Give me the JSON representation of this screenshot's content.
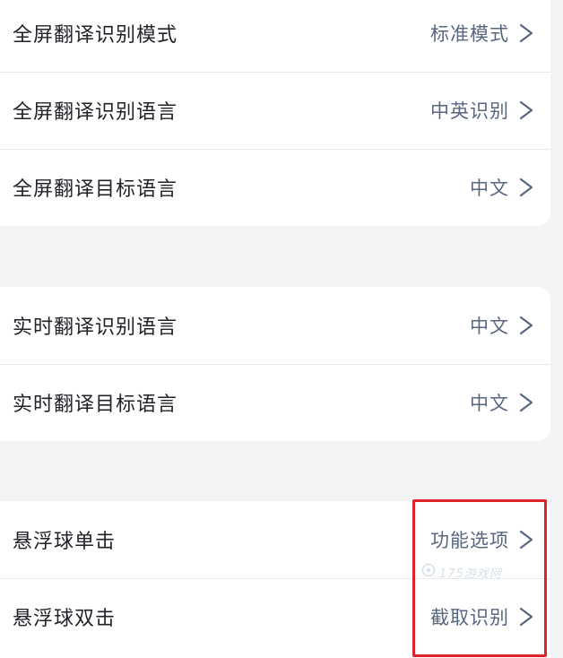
{
  "sections": [
    {
      "rows": [
        {
          "label": "全屏翻译识别模式",
          "value": "标准模式"
        },
        {
          "label": "全屏翻译识别语言",
          "value": "中英识别"
        },
        {
          "label": "全屏翻译目标语言",
          "value": "中文"
        }
      ]
    },
    {
      "rows": [
        {
          "label": "实时翻译识别语言",
          "value": "中文"
        },
        {
          "label": "实时翻译目标语言",
          "value": "中文"
        }
      ]
    },
    {
      "rows": [
        {
          "label": "悬浮球单击",
          "value": "功能选项"
        },
        {
          "label": "悬浮球双击",
          "value": "截取识别"
        }
      ]
    }
  ],
  "watermark": {
    "text": "175游戏网"
  },
  "colors": {
    "background": "#f2f3f5",
    "card": "#ffffff",
    "label_text": "#1f2228",
    "value_text": "#586680",
    "highlight": "#e0232b"
  },
  "icons": {
    "row_arrow": "chevron-right-icon"
  }
}
